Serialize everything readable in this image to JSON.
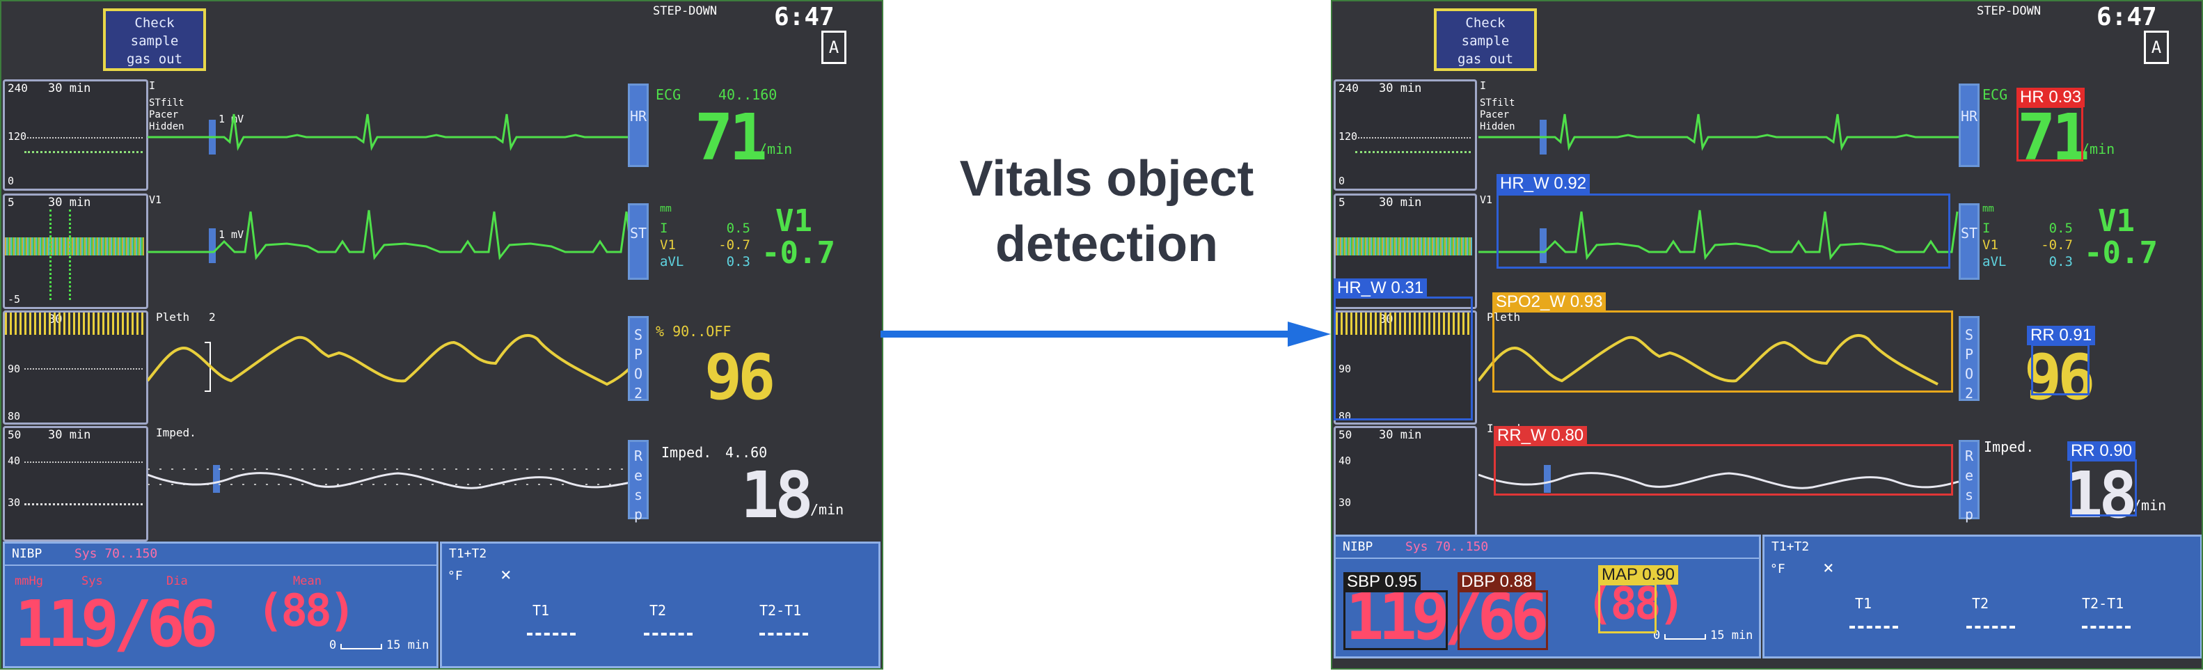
{
  "center": {
    "title_line1": "Vitals object",
    "title_line2": "detection"
  },
  "colors": {
    "arrow": "#1f6fe0",
    "ecg": "#4fe04a",
    "spo2": "#e8cf3c",
    "resp": "#e8e8f0",
    "nibp": "#ff4a6a",
    "hr_box": "#e52b2b",
    "wave_box": "#2e5fd6",
    "spo2_box": "#e8a81c",
    "rr_w_box": "#e03636"
  },
  "monitor": {
    "alert": [
      "Check",
      "sample",
      "gas out"
    ],
    "unit": "STEP-DOWN",
    "time": "6:47",
    "battery": "A",
    "trend1": {
      "scale": "240",
      "period": "30 min",
      "mid": "120",
      "bottom": "0"
    },
    "trend2": {
      "scale": "5",
      "period": "30 min",
      "bottom": "-5"
    },
    "trend3": {
      "period": "30",
      "mid": "90",
      "bottom": "80"
    },
    "trend4": {
      "scale": "50",
      "period": "30 min",
      "mid": "40",
      "low": "30"
    },
    "ecg_lead": "I",
    "ecg_info": [
      "STfilt",
      "Pacer",
      "Hidden"
    ],
    "mv": "1 mV",
    "v1_lead": "V1",
    "pleth": "Pleth",
    "pleth_size": "2",
    "imped": "Imped.",
    "chip_hr": "HR",
    "chip_st": "ST",
    "chip_spo2": "SPO2",
    "chip_resp": "Resp",
    "ecg_label": "ECG",
    "ecg_range": "40..160",
    "hr_value": "71",
    "per_min": "/min",
    "st_unit": "mm",
    "st_leads": [
      "I",
      "V1",
      "aVL"
    ],
    "st_values": [
      "0.5",
      "-0.7",
      "0.3"
    ],
    "st_main_lead": "V1",
    "st_main_value": "-0.7",
    "spo2_label": "% 90..OFF",
    "spo2_value": "96",
    "imped_label": "Imped.",
    "imped_range": "4..60",
    "rr_value": "18",
    "nibp_title": "NIBP",
    "nibp_range": "Sys 70..150",
    "nibp_unit": "mmHg",
    "nibp_sys": "Sys",
    "nibp_dia": "Dia",
    "nibp_mean": "Mean",
    "nibp_value": "119/66",
    "nibp_mean_value": "(88)",
    "nibp_interval": "0",
    "nibp_interval_unit": "15 min",
    "temp_title": "T1+T2",
    "temp_unit": "°F",
    "temp_cols": [
      "T1",
      "T2",
      "T2-T1"
    ]
  },
  "detections": {
    "hr": "HR 0.93",
    "hr_w": "HR_W 0.92",
    "hr_w2": "HR_W 0.31",
    "spo2_w": "SPO2_W 0.93",
    "rr": "RR 0.91",
    "rr_w": "RR_W 0.80",
    "rr2": "RR 0.90",
    "sbp": "SBP 0.95",
    "dbp": "DBP 0.88",
    "map": "MAP 0.90"
  }
}
